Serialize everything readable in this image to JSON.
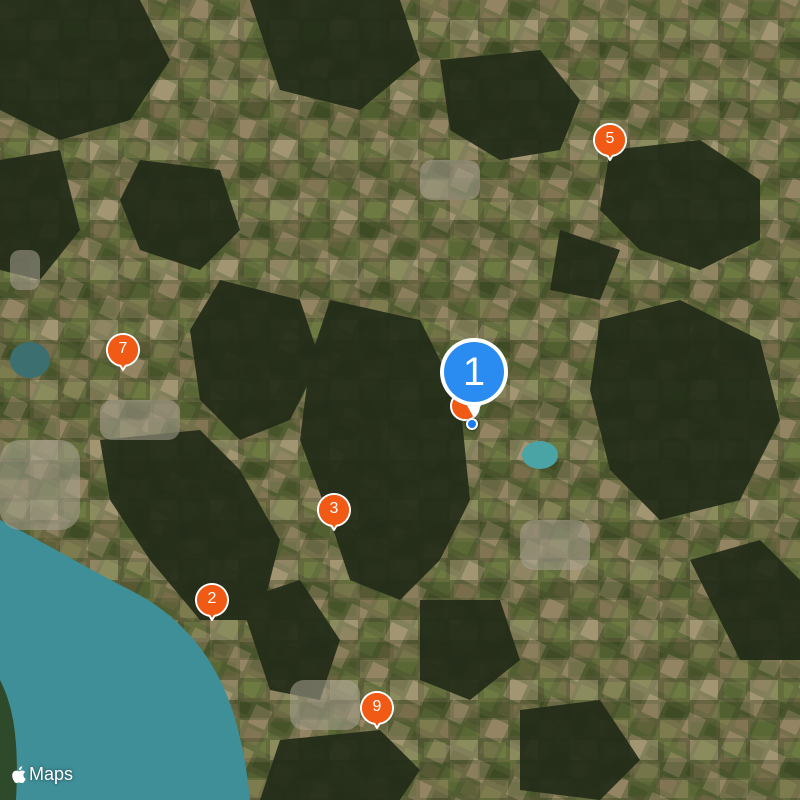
{
  "map": {
    "type": "satellite",
    "colors": {
      "water": "#3f8f99",
      "forest": "#26301c",
      "field": "#6b6a45",
      "pin_orange": "#f05a14",
      "pin_blue": "#2a8cf0"
    }
  },
  "pins": [
    {
      "label": "1",
      "kind": "primary",
      "color": "#2a8cf0"
    },
    {
      "label": "2",
      "kind": "marker",
      "color": "#f05a14"
    },
    {
      "label": "3",
      "kind": "marker",
      "color": "#f05a14"
    },
    {
      "label": "5",
      "kind": "marker",
      "color": "#f05a14"
    },
    {
      "label": "7",
      "kind": "marker",
      "color": "#f05a14"
    },
    {
      "label": "9",
      "kind": "marker",
      "color": "#f05a14"
    }
  ],
  "attribution": {
    "icon": "apple-logo-icon",
    "text": "Maps"
  }
}
